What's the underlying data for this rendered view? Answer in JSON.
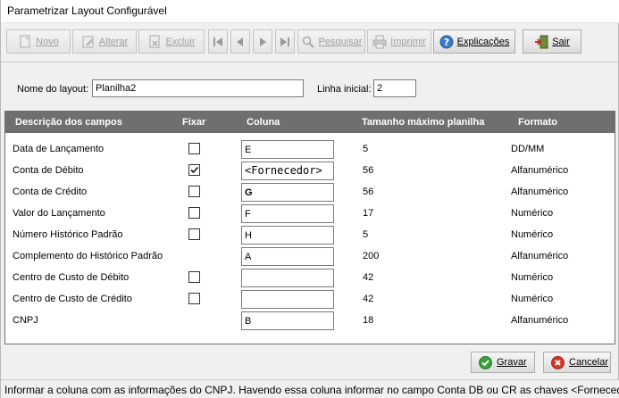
{
  "window": {
    "title": "Parametrizar Layout Configurável"
  },
  "toolbar": {
    "novo": "Novo",
    "alterar": "Alterar",
    "excluir": "Excluir",
    "pesquisar": "Pesquisar",
    "imprimir": "Imprimir",
    "explicacoes": "Explicações",
    "sair": "Sair"
  },
  "form": {
    "layout_name_label": "Nome do layout:",
    "layout_name_value": "Planilha2",
    "start_line_label": "Linha inicial:",
    "start_line_value": "2"
  },
  "grid": {
    "headers": [
      "Descrição dos campos",
      "Fixar",
      "Coluna",
      "Tamanho máximo planilha",
      "Formato"
    ],
    "rows": [
      {
        "descricao": "Data de Lançamento",
        "fixar": false,
        "has_check": true,
        "coluna": "E",
        "tamanho": "5",
        "formato": "DD/MM"
      },
      {
        "descricao": "Conta de Débito",
        "fixar": true,
        "has_check": true,
        "coluna": "<Fornecedor>",
        "tamanho": "56",
        "formato": "Alfanumérico"
      },
      {
        "descricao": "Conta de Crédito",
        "fixar": false,
        "has_check": true,
        "coluna": "G",
        "tamanho": "56",
        "formato": "Alfanumérico"
      },
      {
        "descricao": "Valor do Lançamento",
        "fixar": false,
        "has_check": true,
        "coluna": "F",
        "tamanho": "17",
        "formato": "Numérico"
      },
      {
        "descricao": "Número Histórico Padrão",
        "fixar": false,
        "has_check": true,
        "coluna": "H",
        "tamanho": "5",
        "formato": "Numérico"
      },
      {
        "descricao": "Complemento do Histórico Padrão",
        "fixar": false,
        "has_check": false,
        "coluna": "A",
        "tamanho": "200",
        "formato": "Alfanumérico"
      },
      {
        "descricao": "Centro de Custo de Débito",
        "fixar": false,
        "has_check": true,
        "coluna": "",
        "tamanho": "42",
        "formato": "Numérico"
      },
      {
        "descricao": "Centro de Custo de Crédito",
        "fixar": false,
        "has_check": true,
        "coluna": "",
        "tamanho": "42",
        "formato": "Numérico"
      },
      {
        "descricao": "CNPJ",
        "fixar": false,
        "has_check": false,
        "coluna": "B",
        "tamanho": "18",
        "formato": "Alfanumérico"
      }
    ]
  },
  "actions": {
    "gravar": "Gravar",
    "cancelar": "Cancelar"
  },
  "status": {
    "text": "Informar a coluna com as informações do CNPJ. Havendo essa coluna informar no campo Conta DB ou CR as chaves <Fornecedor"
  },
  "colors": {
    "header_bg": "#6f6f6f",
    "accent_green": "#3aa03a",
    "accent_red": "#d23a2a"
  }
}
